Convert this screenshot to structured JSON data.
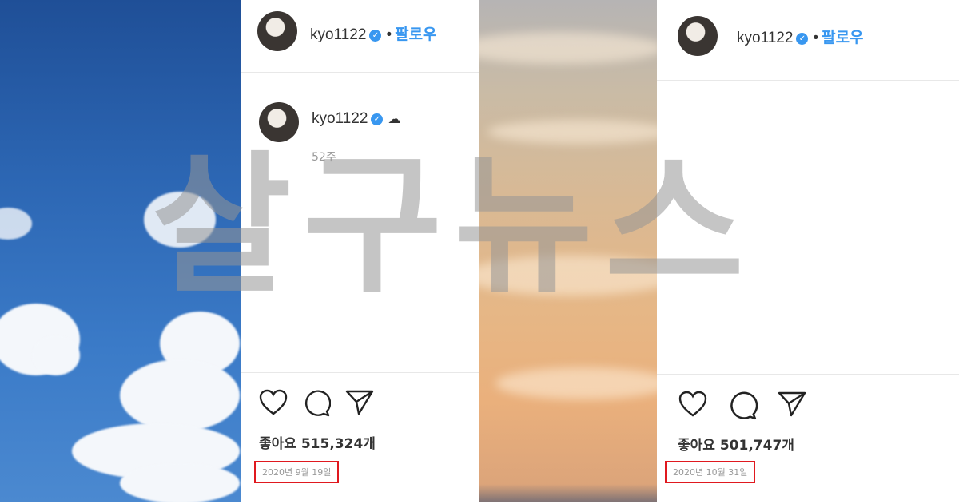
{
  "watermark": "살구뉴스",
  "post_left": {
    "username": "kyo1122",
    "follow_label": "팔로우",
    "caption_username": "kyo1122",
    "weeks_ago": "52주",
    "likes": "좋아요 515,324개",
    "date": "2020년 9월 19일"
  },
  "post_right": {
    "username": "kyo1122",
    "follow_label": "팔로우",
    "likes": "좋아요 501,747개",
    "date": "2020년 10월 31일"
  },
  "colors": {
    "accent": "#3897f0",
    "highlight": "#e0191f"
  },
  "icons": [
    "heart-icon",
    "comment-icon",
    "share-icon",
    "verified-icon",
    "cloud-icon"
  ]
}
